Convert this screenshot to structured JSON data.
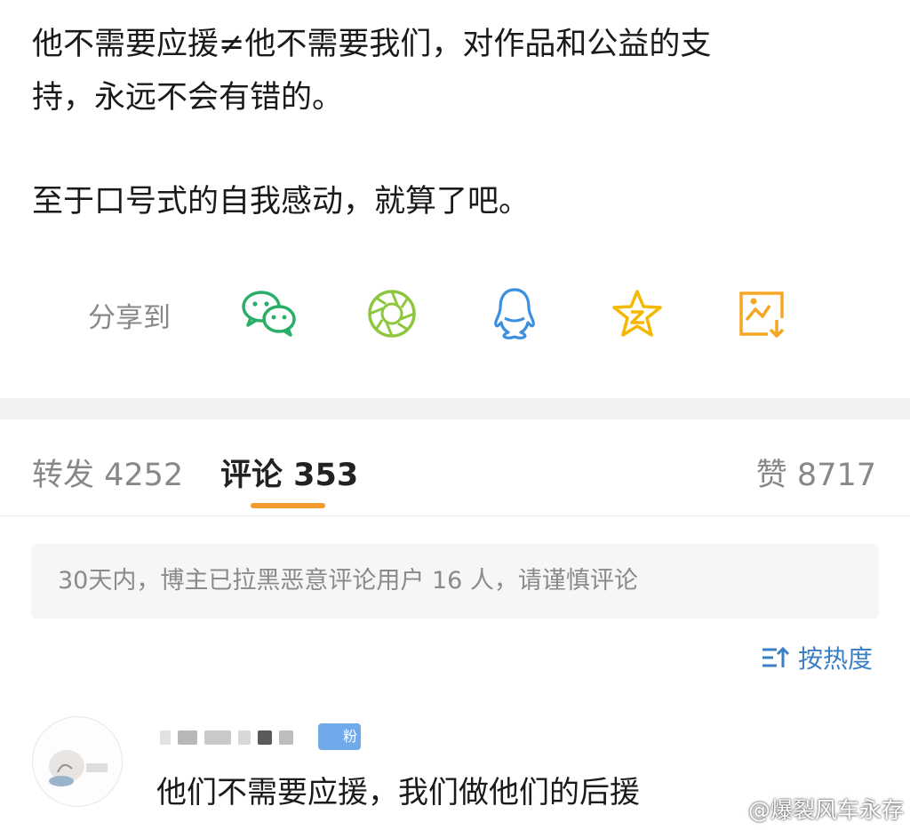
{
  "post": {
    "line1": "他不需要应援≠他不需要我们，对作品和公益的支",
    "line2": "持，永远不会有错的。",
    "line3": "至于口号式的自我感动，就算了吧。"
  },
  "share": {
    "label": "分享到",
    "targets": [
      {
        "icon": "wechat-icon",
        "color": "#2aae67"
      },
      {
        "icon": "moments-icon",
        "color": "#8dc63f"
      },
      {
        "icon": "qq-icon",
        "color": "#3b8fe0"
      },
      {
        "icon": "qzone-icon",
        "color": "#f5b800"
      },
      {
        "icon": "save-image-icon",
        "color": "#f5a623"
      }
    ]
  },
  "tabs": {
    "repost": "转发 4252",
    "comments": "评论 353",
    "likes": "赞 8717",
    "accent": "#f29a2e"
  },
  "notice": "30天内，博主已拉黑恶意评论用户 16 人，请谨慎评论",
  "sort_label": "按热度",
  "comment": {
    "badge": "粉",
    "text": "他们不需要应援，我们做他们的后援"
  },
  "watermark": "@爆裂风车永存"
}
